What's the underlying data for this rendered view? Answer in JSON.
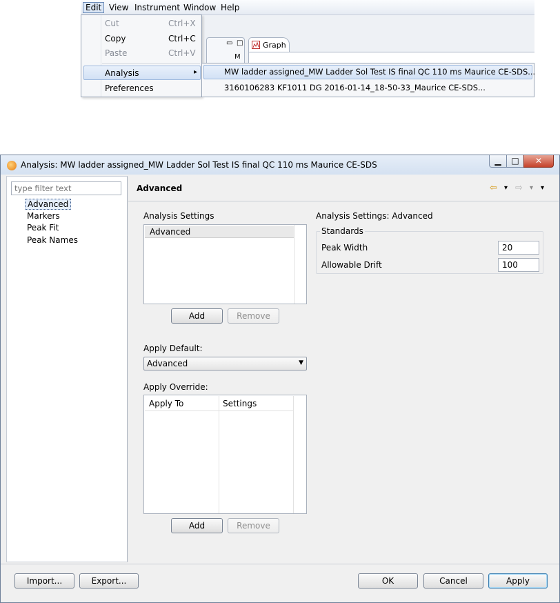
{
  "menu": {
    "bar": [
      "Edit",
      "View",
      "Instrument",
      "Window",
      "Help"
    ],
    "edit_items": [
      {
        "label": "Cut",
        "shortcut": "Ctrl+X"
      },
      {
        "label": "Copy",
        "shortcut": "Ctrl+C"
      },
      {
        "label": "Paste",
        "shortcut": "Ctrl+V"
      },
      {
        "label": "Analysis",
        "arrow": "▸"
      },
      {
        "label": "Preferences"
      }
    ],
    "analysis_submenu": [
      "MW ladder assigned_MW Ladder Sol Test IS final QC 110 ms Maurice CE-SDS...",
      "3160106283 KF1011 DG 2016-01-14_18-50-33_Maurice CE-SDS..."
    ],
    "graph_tab": "Graph",
    "view_a_glyphs": {
      "min": "▭",
      "max": "□",
      "letter": "M"
    }
  },
  "dialog": {
    "title": "Analysis: MW ladder assigned_MW Ladder Sol Test IS final QC 110 ms Maurice CE-SDS",
    "window_buttons": {
      "min": "▁",
      "max": "□",
      "close": "✕"
    },
    "filter_placeholder": "type filter text",
    "tree": [
      "Advanced",
      "Markers",
      "Peak Fit",
      "Peak Names"
    ],
    "page_title": "Advanced",
    "nav_icons": {
      "back": "⇦",
      "back_menu": "▾",
      "forward": "⇨",
      "forward_menu": "▾",
      "view_menu": "▾"
    },
    "analysis_settings": {
      "label": "Analysis Settings",
      "items": [
        "Advanced"
      ],
      "add": "Add",
      "remove": "Remove"
    },
    "apply_default": {
      "label": "Apply Default:",
      "value": "Advanced",
      "arrow": "▼"
    },
    "apply_override": {
      "label": "Apply Override:",
      "columns": [
        "Apply To",
        "Settings"
      ],
      "add": "Add",
      "remove": "Remove"
    },
    "details": {
      "title": "Analysis Settings: Advanced",
      "group": "Standards",
      "fields": [
        {
          "label": "Peak Width",
          "value": "20"
        },
        {
          "label": "Allowable Drift",
          "value": "100"
        }
      ]
    },
    "buttons": {
      "import": "Import...",
      "export": "Export...",
      "ok": "OK",
      "cancel": "Cancel",
      "apply": "Apply"
    }
  }
}
